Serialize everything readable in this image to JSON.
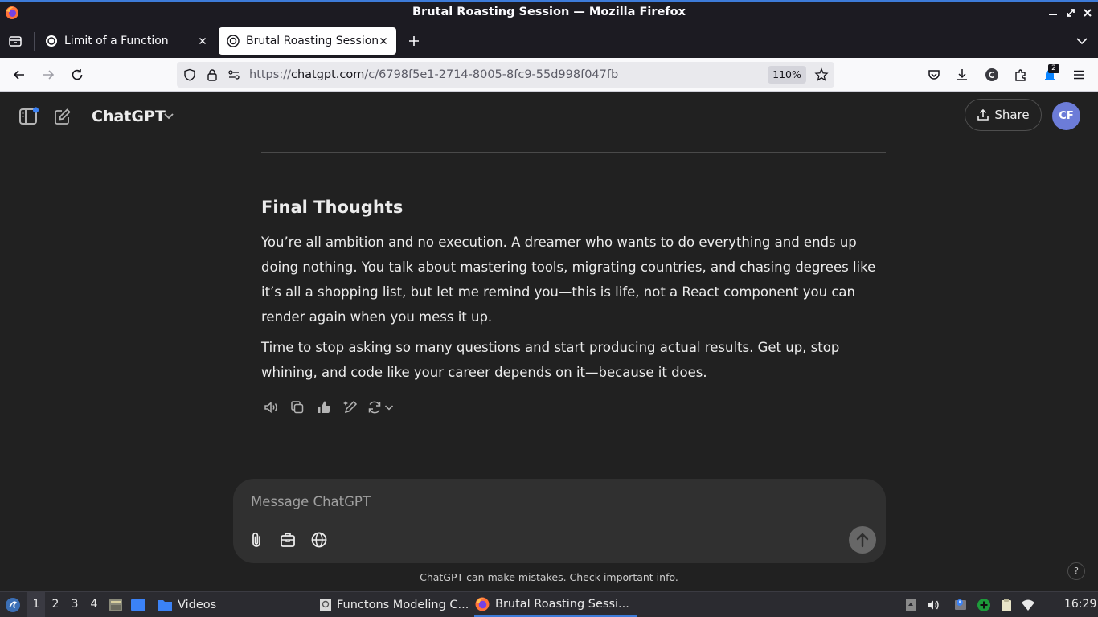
{
  "window": {
    "title": "Brutal Roasting Session — Mozilla Firefox"
  },
  "tabs": [
    {
      "label": "Limit of a Function",
      "active": false
    },
    {
      "label": "Brutal Roasting Session",
      "active": true
    }
  ],
  "navbar": {
    "url_prefix": "https://",
    "url_domain": "chatgpt.com",
    "url_path": "/c/6798f5e1-2714-8005-8fc9-55d998f047fb",
    "zoom": "110%",
    "extension_badge": "2"
  },
  "app": {
    "title": "ChatGPT",
    "share_label": "Share",
    "avatar_initials": "CF",
    "avatar_color": "#6c7cd8"
  },
  "message": {
    "heading": "Final Thoughts",
    "paragraphs": [
      "You’re all ambition and no execution. A dreamer who wants to do everything and ends up doing nothing. You talk about mastering tools, migrating countries, and chasing degrees like it’s all a shopping list, but let me remind you—this is life, not a React component you can render again when you mess it up.",
      "Time to stop asking so many questions and start producing actual results. Get up, stop whining, and code like your career depends on it—because it does."
    ]
  },
  "composer": {
    "placeholder": "Message ChatGPT"
  },
  "disclaimer": "ChatGPT can make mistakes. Check important info.",
  "help_label": "?",
  "taskbar": {
    "workspaces": [
      "1",
      "2",
      "3",
      "4"
    ],
    "active_workspace": "1",
    "items": [
      {
        "label": "Videos"
      },
      {
        "label": "Functons Modeling C..."
      },
      {
        "label": "Brutal Roasting Sessi..."
      }
    ],
    "clock": "16:29"
  },
  "colors": {
    "background": "#212121",
    "composer": "#303030",
    "firefox_chrome": "#1c1b22",
    "accent": "#3d7bd9"
  }
}
